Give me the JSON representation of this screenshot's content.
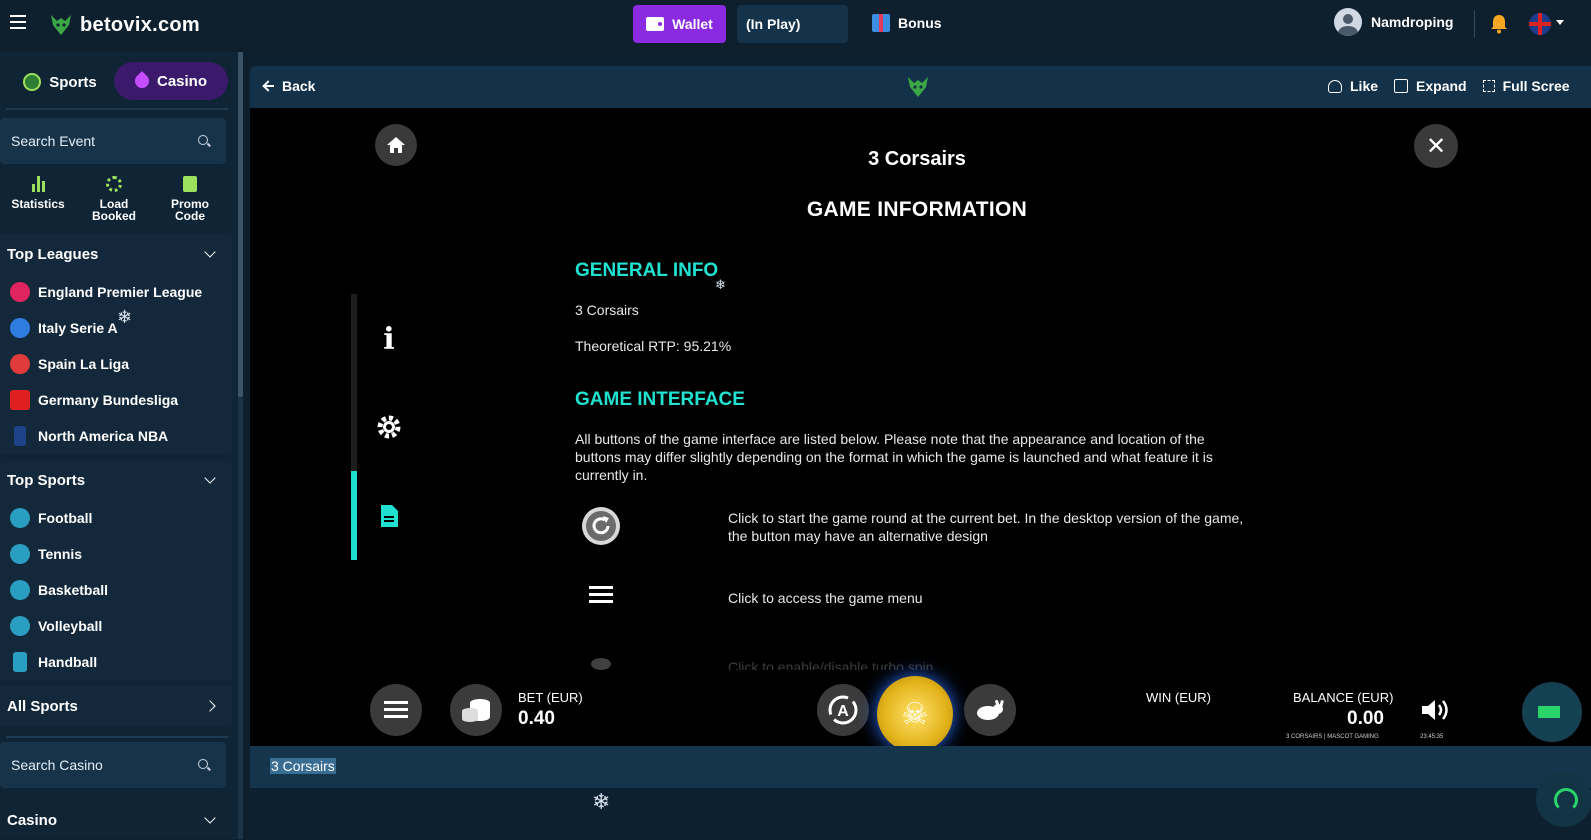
{
  "topbar": {
    "brand": "betovix.com",
    "wallet": "Wallet",
    "in_play": "(In Play)",
    "bonus": "Bonus",
    "username": "Namdroping"
  },
  "sidebar": {
    "sports_tab": "Sports",
    "casino_tab": "Casino",
    "search_event_placeholder": "Search Event",
    "quick_links": [
      {
        "label": "Statistics",
        "icon": "bar-chart-icon"
      },
      {
        "label": "Load Booked",
        "icon": "loading-icon"
      },
      {
        "label": "Promo Code",
        "icon": "promo-code-icon"
      }
    ],
    "top_leagues": {
      "title": "Top Leagues",
      "items": [
        {
          "label": "England Premier League",
          "color": "#e0245e"
        },
        {
          "label": "Italy Serie A",
          "color": "#2f7de1"
        },
        {
          "label": "Spain La Liga",
          "color": "#e23b3b"
        },
        {
          "label": "Germany Bundesliga",
          "color": "#e02020"
        },
        {
          "label": "North America NBA",
          "color": "#1d428a"
        }
      ]
    },
    "top_sports": {
      "title": "Top Sports",
      "items": [
        {
          "label": "Football"
        },
        {
          "label": "Tennis"
        },
        {
          "label": "Basketball"
        },
        {
          "label": "Volleyball"
        },
        {
          "label": "Handball"
        }
      ]
    },
    "all_sports": "All Sports",
    "search_casino_placeholder": "Search Casino",
    "casino_section": "Casino"
  },
  "game_header": {
    "back": "Back",
    "like": "Like",
    "expand": "Expand",
    "fullscreen": "Full Scree"
  },
  "game": {
    "title": "3 Corsairs",
    "info_title": "GAME INFORMATION",
    "general_info_heading": "GENERAL INFO",
    "general_info_name": "3 Corsairs",
    "rtp": "Theoretical RTP: 95.21%",
    "interface_heading": "GAME INTERFACE",
    "interface_intro": "All buttons of the game interface are listed below. Please note that the appearance and location of the buttons may differ slightly depending on the format in which the game is launched and what feature it is currently in.",
    "rows": [
      {
        "icon": "refresh-icon",
        "text": "Click to start the game round at the current bet. In the desktop version of the game, the button may have an alternative design"
      },
      {
        "icon": "menu-icon",
        "text": "Click to access the game menu"
      },
      {
        "icon": "rabbit-icon",
        "text": "Click to enable/disable turbo spin"
      }
    ],
    "bet_label": "BET (EUR)",
    "bet_value": "0.40",
    "win_label": "WIN (EUR)",
    "balance_label": "BALANCE (EUR)",
    "balance_value": "0.00",
    "provider": "3 CORSAIRS | MASCOT GAMING",
    "clock": "23:45:35"
  },
  "bottom_bar": {
    "game_name": "3 Corsairs"
  }
}
